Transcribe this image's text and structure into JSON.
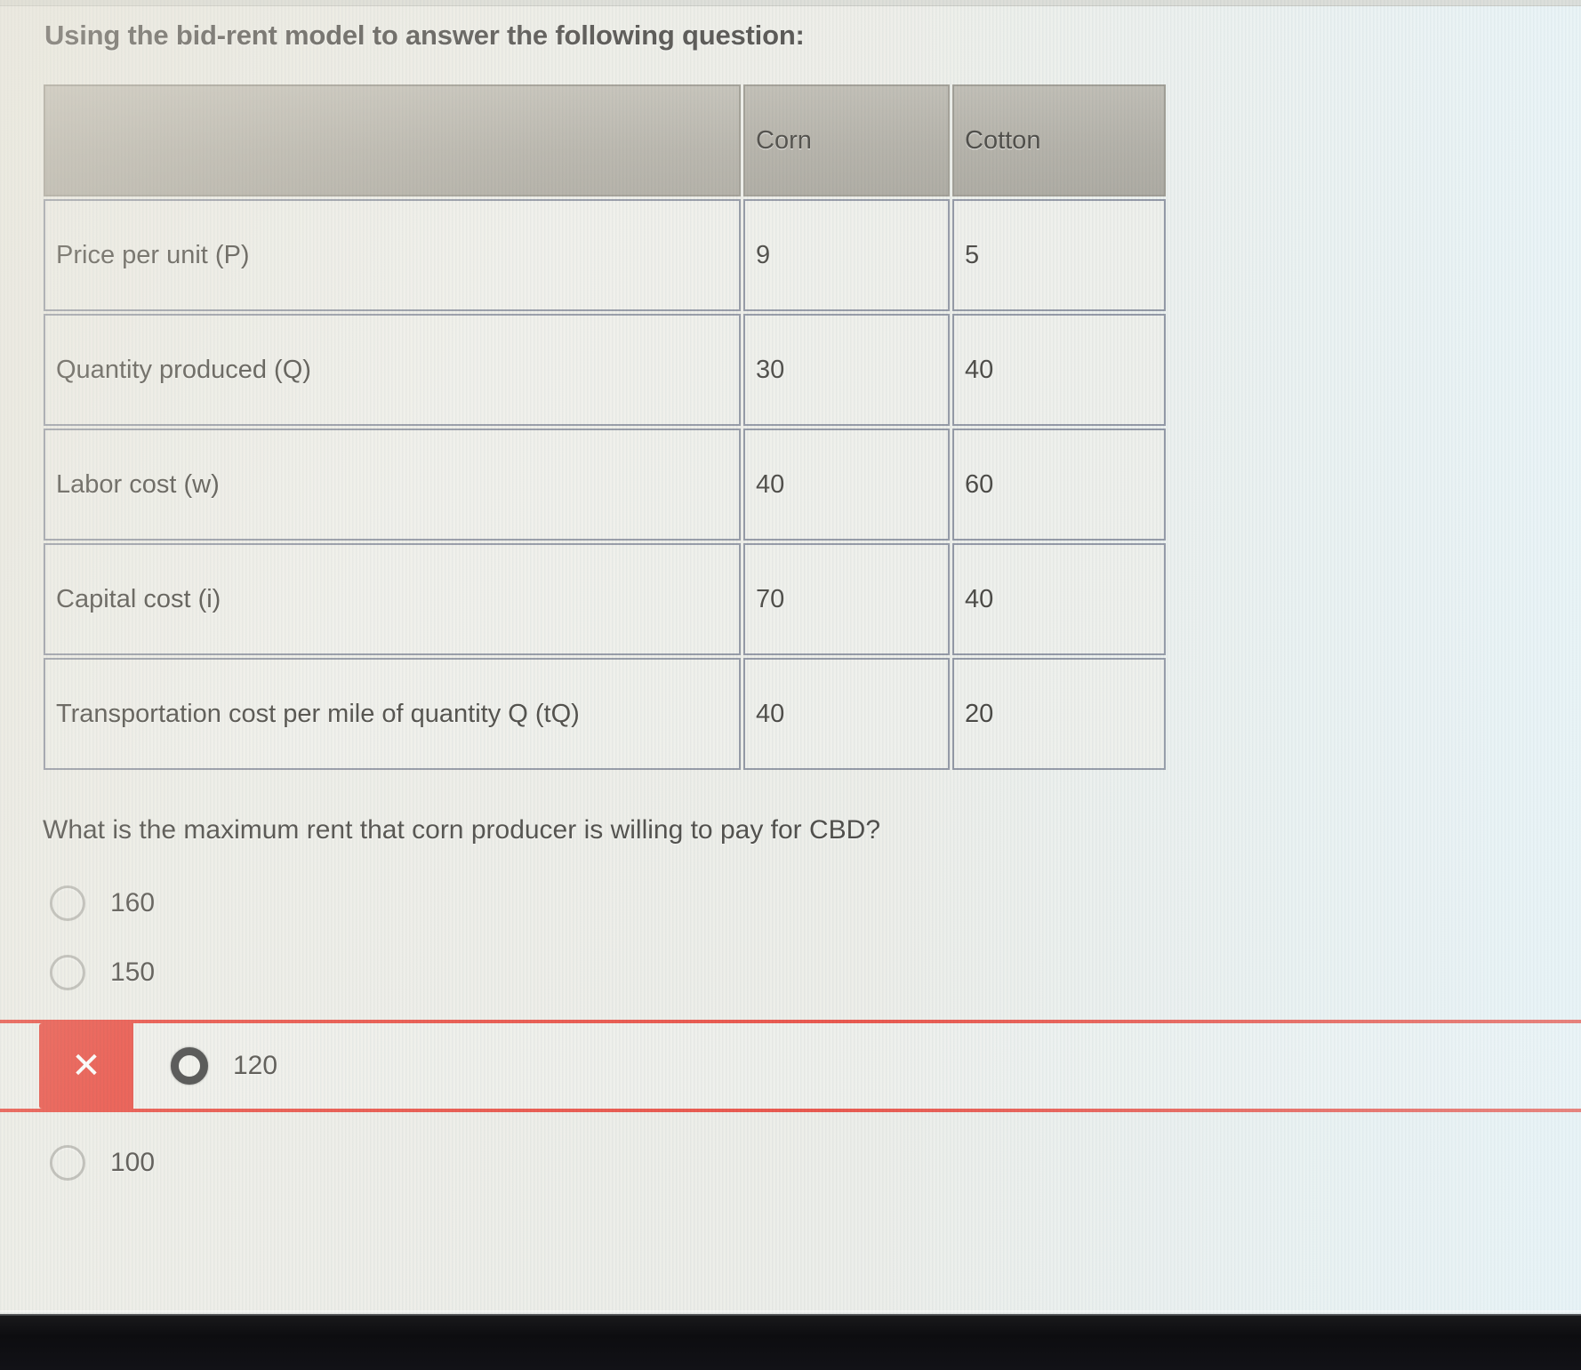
{
  "prompt": "Using the bid-rent model to answer the following question:",
  "table": {
    "columns": [
      "",
      "Corn",
      "Cotton"
    ],
    "rows": [
      {
        "label": "Price per unit (P)",
        "corn": "9",
        "cotton": "5"
      },
      {
        "label": "Quantity produced (Q)",
        "corn": "30",
        "cotton": "40"
      },
      {
        "label": "Labor cost (w)",
        "corn": "40",
        "cotton": "60"
      },
      {
        "label": "Capital cost (i)",
        "corn": "70",
        "cotton": "40"
      },
      {
        "label": "Transportation cost per mile of quantity Q (tQ)",
        "corn": "40",
        "cotton": "20"
      }
    ]
  },
  "question": "What is the maximum rent that corn producer is willing to pay for CBD?",
  "options": [
    {
      "label": "160",
      "selected": false,
      "state": "none"
    },
    {
      "label": "150",
      "selected": false,
      "state": "none"
    },
    {
      "label": "120",
      "selected": true,
      "state": "incorrect",
      "mark": "✕"
    },
    {
      "label": "100",
      "selected": false,
      "state": "none"
    }
  ],
  "colors": {
    "incorrect": "#e8372b",
    "header_fill": "#a9a59b",
    "cell_border": "#7f8595"
  }
}
